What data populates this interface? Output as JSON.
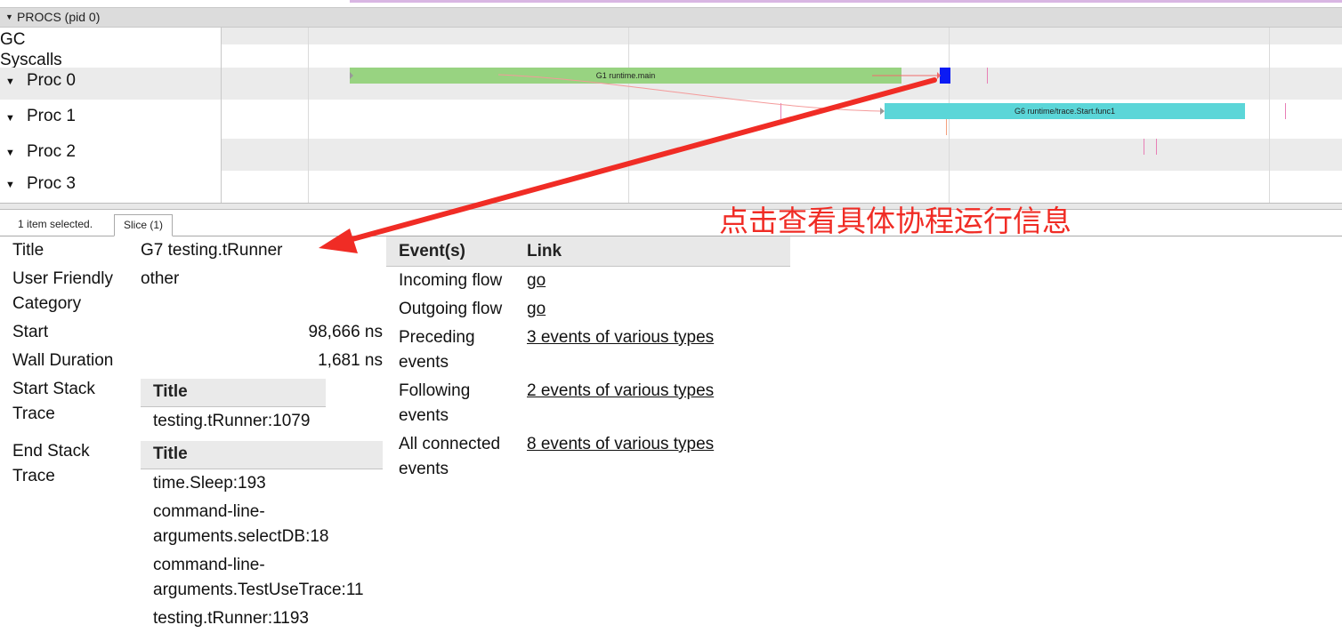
{
  "timeline": {
    "section_title": "PROCS (pid 0)",
    "rows": [
      "GC",
      "Syscalls"
    ],
    "procs": [
      "Proc 0",
      "Proc 1",
      "Proc 2",
      "Proc 3"
    ],
    "slices": [
      {
        "label": "G1 runtime.main",
        "color": "#98d381"
      },
      {
        "label": "G6 runtime/trace.Start.func1",
        "color": "#5bd6d8"
      }
    ],
    "selected_color": "#0b1bf4"
  },
  "selection": {
    "count_label": "1 item selected.",
    "tab_label": "Slice (1)"
  },
  "details": {
    "title_label": "Title",
    "title_value": "G7 testing.tRunner",
    "category_label": [
      "User Friendly",
      "Category"
    ],
    "category_value": "other",
    "start_label": "Start",
    "start_value": "98,666 ns",
    "wall_label": "Wall Duration",
    "wall_value": "1,681 ns",
    "start_stack_label": [
      "Start Stack",
      "Trace"
    ],
    "start_stack_header": "Title",
    "start_stack": [
      "testing.tRunner:1079"
    ],
    "end_stack_label": [
      "End Stack",
      "Trace"
    ],
    "end_stack_header": "Title",
    "end_stack": [
      "time.Sleep:193",
      "command-line-",
      "arguments.selectDB:18",
      "command-line-",
      "arguments.TestUseTrace:11",
      "testing.tRunner:1193"
    ]
  },
  "links": {
    "col_events": "Event(s)",
    "col_link": "Link",
    "rows": [
      {
        "event": [
          "Incoming flow"
        ],
        "link": "go"
      },
      {
        "event": [
          "Outgoing flow"
        ],
        "link": "go"
      },
      {
        "event": [
          "Preceding",
          "events"
        ],
        "link": "3 events of various types"
      },
      {
        "event": [
          "Following",
          "events"
        ],
        "link": "2 events of various types"
      },
      {
        "event": [
          "All connected",
          "events"
        ],
        "link": "8 events of various types"
      }
    ]
  },
  "annotation": {
    "text": "点击查看具体协程运行信息",
    "color": "#f02c25"
  }
}
